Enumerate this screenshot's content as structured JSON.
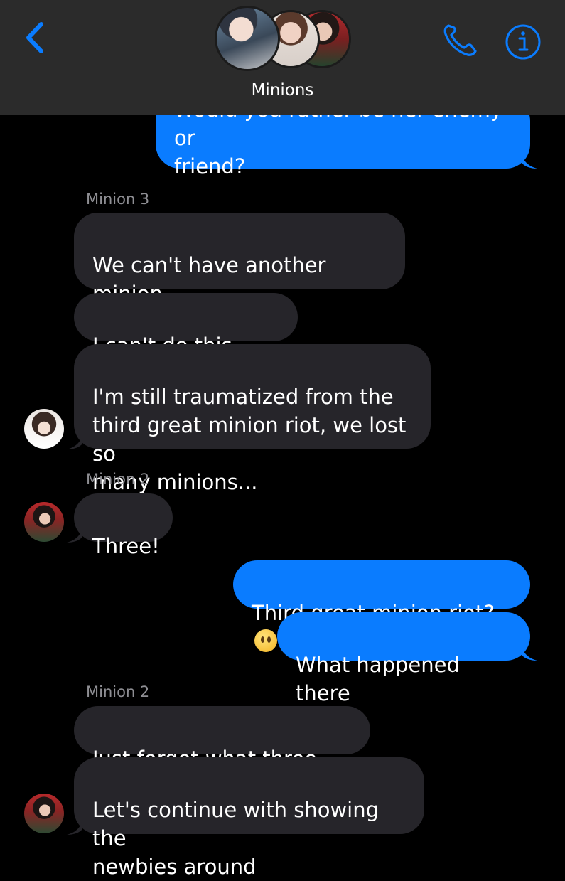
{
  "header": {
    "title": "Minions",
    "back_icon": "chevron-left-icon",
    "call_icon": "phone-icon",
    "info_icon": "info-icon",
    "accent_color": "#0a7cff"
  },
  "messages": [
    {
      "from": "me",
      "text": "Would you rather be her enemy or friend?"
    },
    {
      "sender": "Minion 3"
    },
    {
      "from": "Minion 3",
      "text": "We can't have another minion riot"
    },
    {
      "from": "Minion 3",
      "text": "I can't do this again"
    },
    {
      "from": "Minion 3",
      "text": "I'm still traumatized from the third great minion riot, we lost so many minions..."
    },
    {
      "sender": "Minion 2"
    },
    {
      "from": "Minion 2",
      "text": "Three!"
    },
    {
      "from": "me",
      "text": "Third great minion riot?",
      "emoji": "face-without-mouth"
    },
    {
      "from": "me",
      "text": "What happened there"
    },
    {
      "sender": "Minion 2"
    },
    {
      "from": "Minion 2",
      "text": "Just forget what three said"
    },
    {
      "from": "Minion 2",
      "text": "Let's continue with showing the newbies around"
    }
  ],
  "lines": {
    "m0": "Would you rather be her enemy or\nfriend?",
    "m2": "We can't have another minion\nriot",
    "m4": "I'm still traumatized from the\nthird great minion riot, we lost so\nmany minions...",
    "m11": "Let's continue with showing the\nnewbies around"
  }
}
